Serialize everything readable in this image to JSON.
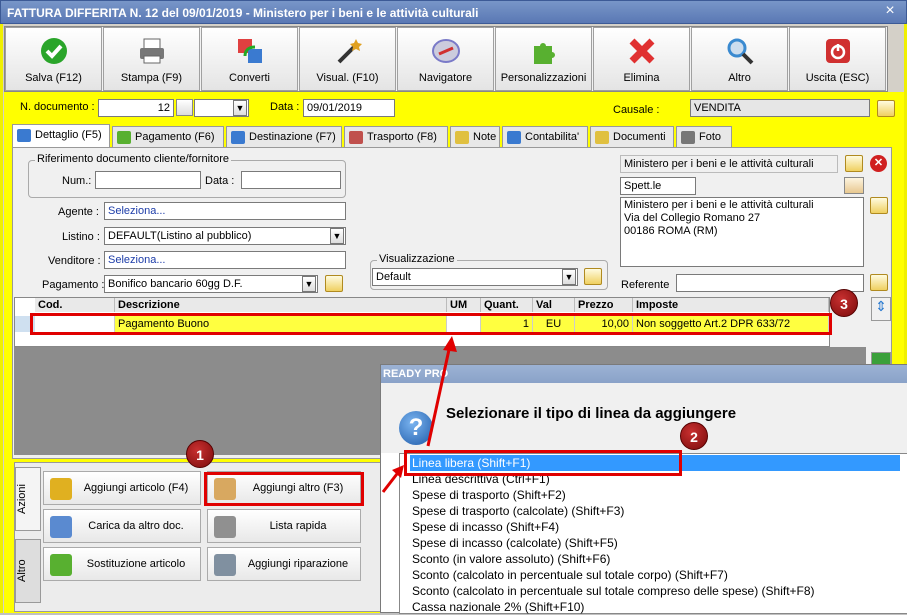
{
  "window": {
    "title": "FATTURA DIFFERITA N. 12 del 09/01/2019 - Ministero per i beni e le attività culturali",
    "close": "×"
  },
  "toolbar": [
    {
      "label": "Salva (F12)",
      "icon": "check-icon",
      "color": "#2aa52a"
    },
    {
      "label": "Stampa (F9)",
      "icon": "printer-icon",
      "color": "#777777"
    },
    {
      "label": "Converti",
      "icon": "convert-icon",
      "color": "#3a7ad0"
    },
    {
      "label": "Visual. (F10)",
      "icon": "magic-wand-icon",
      "color": "#e0a020"
    },
    {
      "label": "Navigatore",
      "icon": "compass-icon",
      "color": "#7a7ac8"
    },
    {
      "label": "Personalizzazioni",
      "icon": "puzzle-icon",
      "color": "#58b030"
    },
    {
      "label": "Elimina",
      "icon": "delete-x-icon",
      "color": "#e03030"
    },
    {
      "label": "Altro",
      "icon": "magnifier-icon",
      "color": "#3a8ad0"
    },
    {
      "label": "Uscita (ESC)",
      "icon": "power-icon",
      "color": "#d03030"
    }
  ],
  "header": {
    "ndoc_label": "N. documento :",
    "ndoc_value": "12",
    "ndoc_suffix": "",
    "data_label": "Data :",
    "data_value": "09/01/2019",
    "causale_label": "Causale :",
    "causale_value": "VENDITA"
  },
  "tabs": [
    "Dettaglio (F5)",
    "Pagamento (F6)",
    "Destinazione (F7)",
    "Trasporto (F8)",
    "Note",
    "Contabilita'",
    "Documenti",
    "Foto"
  ],
  "riferimento": {
    "title": "Riferimento documento cliente/fornitore",
    "num_label": "Num.:",
    "num_value": "",
    "data_label": "Data :",
    "data_value": ""
  },
  "fields": {
    "agente_label": "Agente :",
    "agente_value": "Seleziona...",
    "listino_label": "Listino :",
    "listino_value": "DEFAULT(Listino al pubblico)",
    "venditore_label": "Venditore :",
    "venditore_value": "Seleziona...",
    "pagamento_label": "Pagamento :",
    "pagamento_value": "Bonifico bancario 60gg D.F.",
    "visual_title": "Visualizzazione",
    "visual_value": "Default"
  },
  "customer": {
    "name": "Ministero per i beni e le attività culturali",
    "title": "Spett.le",
    "address": [
      "Ministero per i beni e le attività culturali",
      "Via del Collegio Romano 27",
      "00186 ROMA (RM)"
    ],
    "referente_label": "Referente",
    "referente_value": ""
  },
  "grid": {
    "headers": [
      "Cod.",
      "Descrizione",
      "UM",
      "Quant.",
      "Val",
      "Prezzo",
      "Imposte"
    ],
    "rows": [
      [
        "",
        "Pagamento Buono",
        "",
        "1",
        "EU",
        "10,00",
        "Non soggetto Art.2 DPR 633/72"
      ]
    ]
  },
  "actions": {
    "vtabs": [
      "Azioni",
      "Altro"
    ],
    "buttons": [
      "Aggiungi articolo (F4)",
      "Aggiungi altro (F3)",
      "Carica da altro doc.",
      "Lista rapida",
      "Sostituzione articolo",
      "Aggiungi riparazione"
    ]
  },
  "dialog": {
    "title": "READY PRO",
    "message": "Selezionare il tipo di linea da aggiungere",
    "icon": "?",
    "items": [
      "Linea libera (Shift+F1)",
      "Linea descrittiva (Ctrl+F1)",
      "Spese di trasporto (Shift+F2)",
      "Spese di trasporto (calcolate) (Shift+F3)",
      "Spese di incasso (Shift+F4)",
      "Spese di incasso (calcolate) (Shift+F5)",
      "Sconto (in valore assoluto) (Shift+F6)",
      "Sconto (calcolato in percentuale sul totale corpo) (Shift+F7)",
      "Sconto (calcolato in percentuale sul totale compreso delle spese) (Shift+F8)",
      "Cassa nazionale 2% (Shift+F10)"
    ],
    "selected": 0
  },
  "annotations": {
    "badge1": "1",
    "badge2": "2",
    "badge3": "3",
    "color": "#e00000"
  }
}
